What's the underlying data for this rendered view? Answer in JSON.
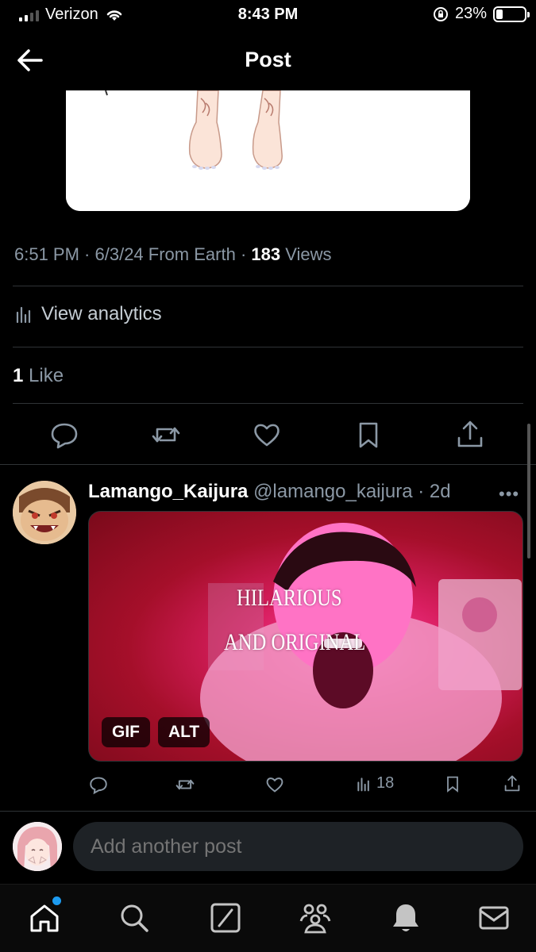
{
  "status_bar": {
    "carrier": "Verizon",
    "time": "8:43 PM",
    "battery": "23%",
    "battery_level": 0.23
  },
  "header": {
    "title": "Post"
  },
  "post": {
    "time": "6:51 PM",
    "date": "6/3/24",
    "source": "From Earth",
    "views_count": "183",
    "views_label": "Views",
    "analytics_label": "View analytics",
    "likes_count": "1",
    "likes_label": "Like"
  },
  "reply": {
    "name": "Lamango_Kaijura",
    "handle": "@lamango_kaijura",
    "age": "2d",
    "more": "•••",
    "gif_text_line1": "HILARIOUS",
    "gif_text_line2": "AND ORIGINAL",
    "gif_badge": "GIF",
    "alt_badge": "ALT",
    "views": "18"
  },
  "compose": {
    "placeholder": "Add another post"
  },
  "icons": {
    "back": "back-arrow-icon",
    "reply": "reply-icon",
    "repost": "repost-icon",
    "like": "heart-icon",
    "bookmark": "bookmark-icon",
    "share": "share-icon",
    "analytics": "analytics-icon",
    "tabs": [
      "home-icon",
      "search-icon",
      "grok-icon",
      "communities-icon",
      "notifications-icon",
      "messages-icon"
    ]
  },
  "colors": {
    "accent": "#1d9bf0",
    "muted": "#8b98a5",
    "background": "#000000"
  }
}
